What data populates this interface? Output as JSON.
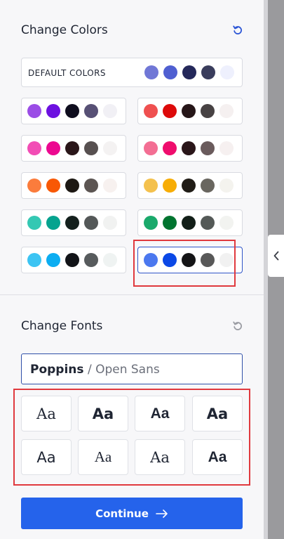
{
  "colors_section": {
    "title": "Change Colors",
    "reset_icon": "reset-icon",
    "default": {
      "label": "DEFAULT COLORS",
      "colors": [
        "#7077d6",
        "#4f5fd1",
        "#24285a",
        "#3a3d5c",
        "#eef0fd"
      ]
    },
    "palettes": [
      {
        "colors": [
          "#9b4de6",
          "#6c10e0",
          "#0f0d1e",
          "#575075",
          "#f1f0f5"
        ]
      },
      {
        "colors": [
          "#ef5050",
          "#dd0a0a",
          "#261618",
          "#474243",
          "#f5f0f0"
        ]
      },
      {
        "colors": [
          "#f24db5",
          "#ec0890",
          "#2a1619",
          "#575050",
          "#f4f2f2"
        ]
      },
      {
        "colors": [
          "#f36e93",
          "#ef0d6d",
          "#2a1619",
          "#6a5b5c",
          "#f6f0f0"
        ]
      },
      {
        "colors": [
          "#fb7c3c",
          "#f85805",
          "#1d1813",
          "#5c5552",
          "#f7f1ef"
        ]
      },
      {
        "colors": [
          "#f4c14d",
          "#f7ad05",
          "#201c16",
          "#69665f",
          "#f4f3ee"
        ]
      },
      {
        "colors": [
          "#34c8b3",
          "#06a38f",
          "#14201d",
          "#545858",
          "#f1f2f1"
        ]
      },
      {
        "colors": [
          "#1aa96b",
          "#00742f",
          "#121e18",
          "#545957",
          "#f2f3f0"
        ]
      },
      {
        "colors": [
          "#3cc4f3",
          "#0cadf1",
          "#121418",
          "#575b5d",
          "#eff3f2"
        ]
      },
      {
        "colors": [
          "#4b78ef",
          "#0b48e6",
          "#141416",
          "#585858",
          "#f1f1f1"
        ]
      }
    ]
  },
  "fonts_section": {
    "title": "Change Fonts",
    "reset_icon": "reset-icon",
    "current_primary": "Poppins",
    "current_separator": "/",
    "current_secondary": "Open Sans",
    "tiles": [
      "Aa",
      "Aa",
      "Aa",
      "Aa",
      "Aa",
      "Aa",
      "Aa",
      "Aa"
    ]
  },
  "continue_button": {
    "label": "Continue",
    "icon": "arrow-right-icon"
  },
  "annotation_color": "#e0393e",
  "accent_color": "#2563eb"
}
